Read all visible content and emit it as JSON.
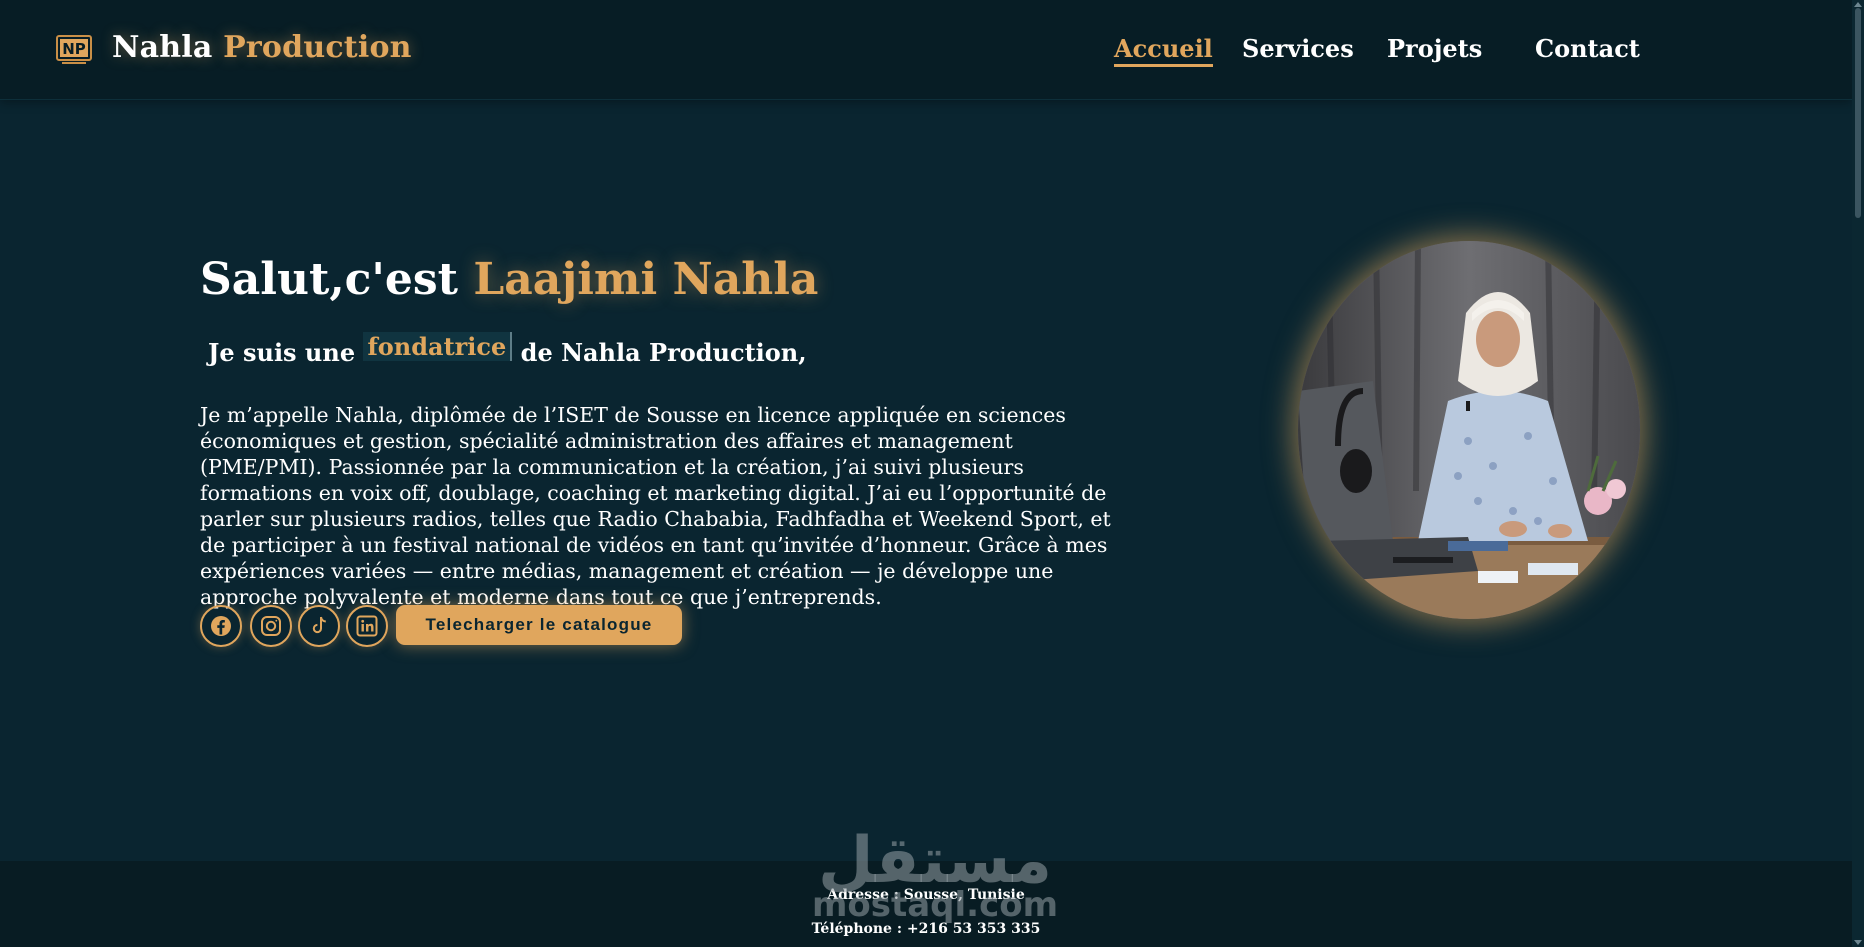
{
  "header": {
    "brand_first": "Nahla",
    "brand_second": "Production",
    "logo_text": "NP"
  },
  "nav": [
    {
      "label": "Accueil",
      "active": true
    },
    {
      "label": "Services",
      "active": false
    },
    {
      "label": "Projets",
      "active": false
    },
    {
      "label": "Contact",
      "active": false
    }
  ],
  "hero": {
    "greeting": "Salut,c'est",
    "name": "Laajimi Nahla",
    "sub_prefix": "Je suis une",
    "sub_role": "fondatrice",
    "sub_suffix": "de Nahla Production,",
    "bio": "Je m’appelle Nahla, diplômée de l’ISET de Sousse en licence appliquée en sciences économiques et gestion, spécialité administration des affaires et management (PME/PMI). Passionnée par la communication et la création, j’ai suivi plusieurs formations en voix off, doublage, coaching et marketing digital. J’ai eu l’opportunité de parler sur plusieurs radios, telles que Radio Chababia, Fadhfadha et Weekend Sport, et de participer à un festival national de vidéos en tant qu’invitée d’honneur. Grâce à mes expériences variées — entre médias, management et création — je développe une approche polyvalente et moderne dans tout ce que j’entreprends.",
    "catalog_button": "Telecharger le catalogue"
  },
  "socials": [
    {
      "icon": "facebook-icon"
    },
    {
      "icon": "instagram-icon"
    },
    {
      "icon": "tiktok-icon"
    },
    {
      "icon": "linkedin-icon"
    }
  ],
  "footer": {
    "address": "Adresse : Sousse, Tunisie",
    "phone": "Téléphone : +216 53 353 335"
  },
  "watermark": {
    "arabic": "مستقل",
    "latin": "mostaql.com"
  },
  "colors": {
    "background": "#0a2530",
    "header": "#071d25",
    "accent": "#e0a65d",
    "text": "#ffffff"
  }
}
